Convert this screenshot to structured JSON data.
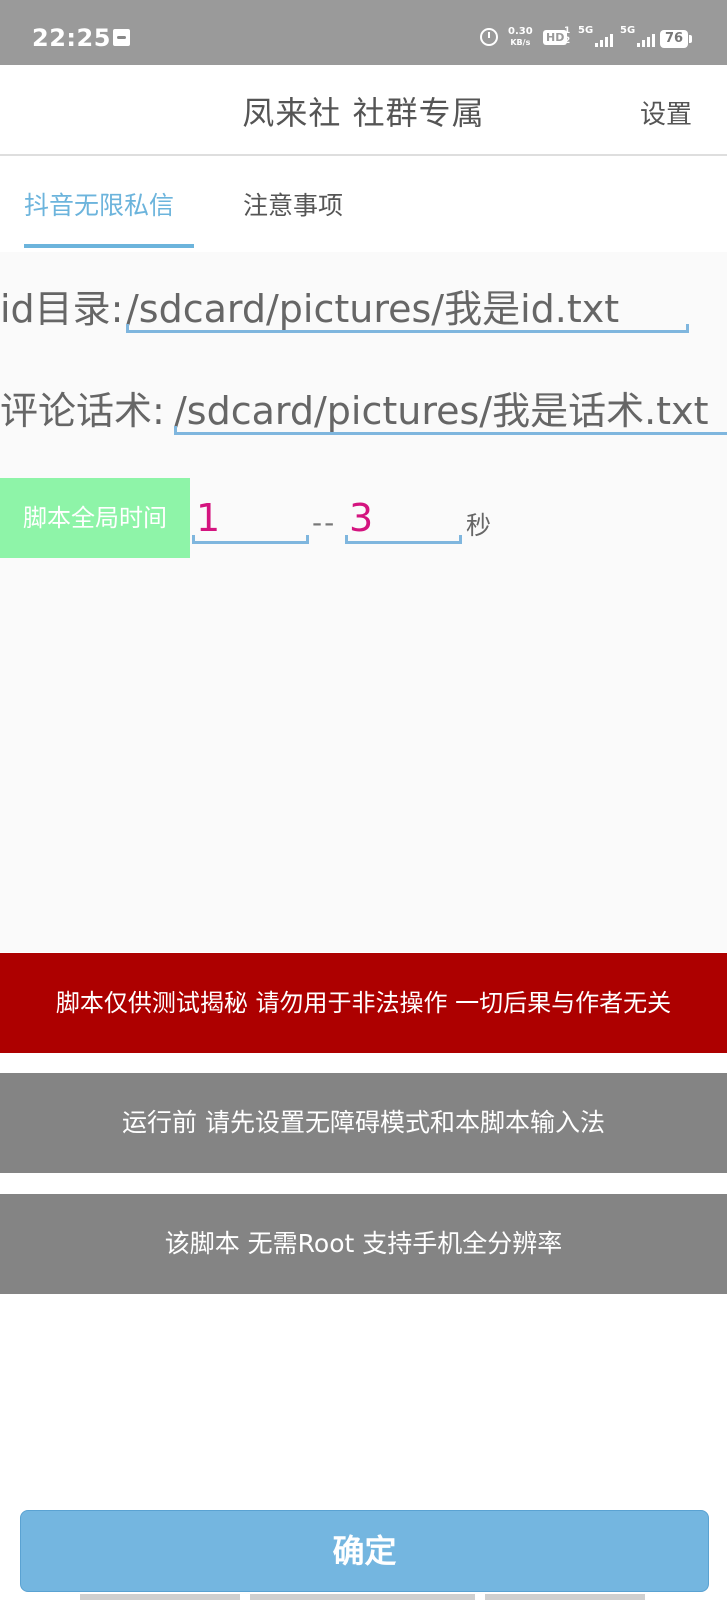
{
  "status_bar": {
    "time": "22:25",
    "net_speed_value": "0.30",
    "net_speed_unit": "KB/s",
    "hd_label": "HD",
    "sim_label": "1 2",
    "signal1_label": "5G",
    "signal2_label": "5G",
    "battery": "76",
    "icons": [
      "notification-icon",
      "alarm-icon",
      "signal-icon",
      "battery-icon"
    ]
  },
  "header": {
    "title": "凤来社 社群专属",
    "settings_label": "设置"
  },
  "tabs": [
    {
      "label": "抖音无限私信",
      "active": true
    },
    {
      "label": "注意事项",
      "active": false
    }
  ],
  "form": {
    "id_label": "id目录:",
    "id_value": "/sdcard/pictures/我是id.txt",
    "comment_label": "评论话术:",
    "comment_value": "/sdcard/pictures/我是话术.txt",
    "time_label": "脚本全局时间",
    "time_min": "1",
    "time_separator": "--",
    "time_max": "3",
    "time_unit": "秒"
  },
  "banners": {
    "warning": "脚本仅供测试揭秘 请勿用于非法操作 一切后果与作者无关",
    "setup": "运行前 请先设置无障碍模式和本脚本输入法",
    "root": "该脚本 无需Root 支持手机全分辨率"
  },
  "confirm_label": "确定",
  "colors": {
    "status_bar": "#9a9a9a",
    "accent": "#6cb4dc",
    "badge": "#8ef4a8",
    "number": "#d4147f",
    "warning": "#ad0000",
    "info": "#848484",
    "confirm": "#74b6e0"
  }
}
